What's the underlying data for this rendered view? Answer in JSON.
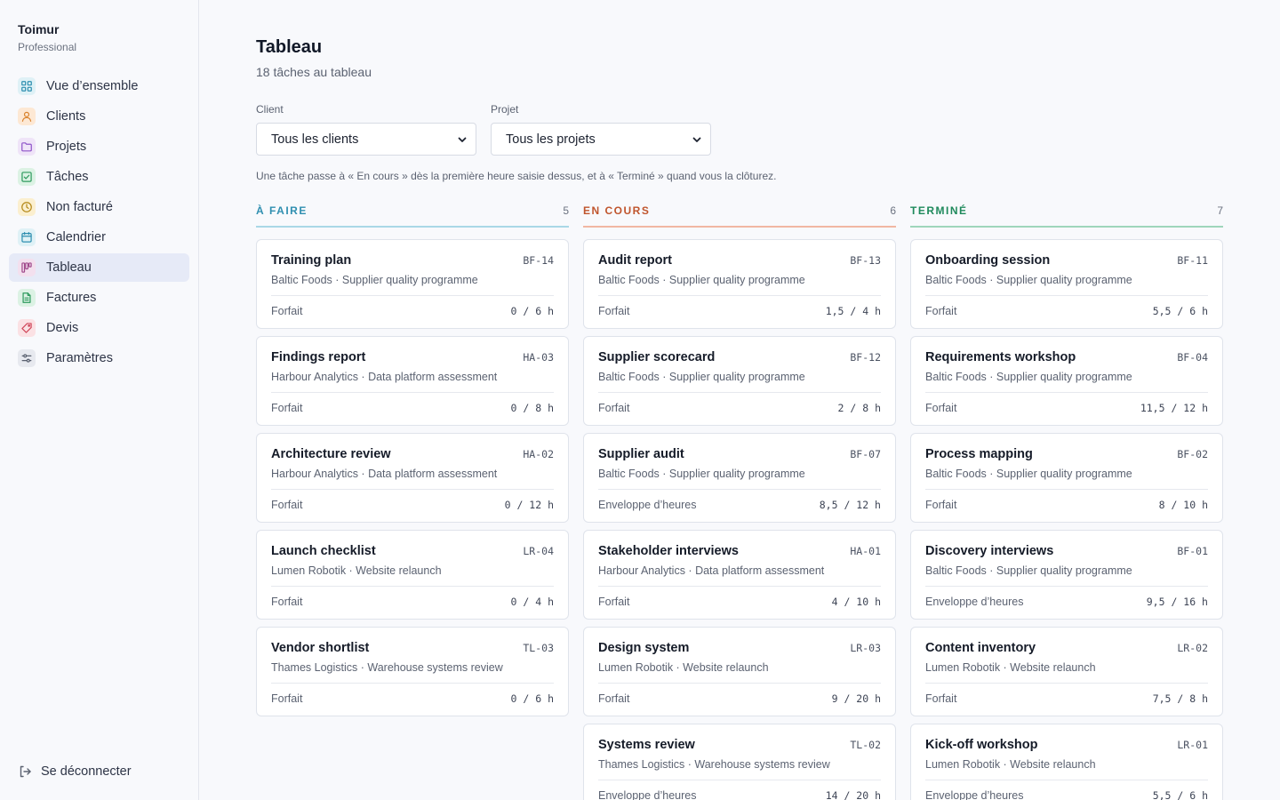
{
  "sidebar": {
    "brand": "Toimur",
    "plan": "Professional",
    "items": [
      {
        "label": "Vue d’ensemble",
        "icon": "grid-icon",
        "color": "#2f8fb0",
        "bg": "#dff1f6"
      },
      {
        "label": "Clients",
        "icon": "user-icon",
        "color": "#d9812b",
        "bg": "#fde8d4"
      },
      {
        "label": "Projets",
        "icon": "folder-icon",
        "color": "#8f55c9",
        "bg": "#efe4f8"
      },
      {
        "label": "Tâches",
        "icon": "checkbox-icon",
        "color": "#2e9a5e",
        "bg": "#dcf2e4"
      },
      {
        "label": "Non facturé",
        "icon": "clock-icon",
        "color": "#b58a1b",
        "bg": "#fbefcf"
      },
      {
        "label": "Calendrier",
        "icon": "calendar-icon",
        "color": "#2f8fb0",
        "bg": "#dff1f6"
      },
      {
        "label": "Tableau",
        "icon": "kanban-icon",
        "color": "#a04a8c",
        "bg": "#f3e0ee"
      },
      {
        "label": "Factures",
        "icon": "invoice-icon",
        "color": "#2e9a5e",
        "bg": "#dcf2e4"
      },
      {
        "label": "Devis",
        "icon": "tag-icon",
        "color": "#d0485b",
        "bg": "#fbe1e4"
      },
      {
        "label": "Paramètres",
        "icon": "sliders-icon",
        "color": "#5b6271",
        "bg": "#e7e9ef"
      }
    ],
    "active": "Tableau",
    "logout": "Se déconnecter"
  },
  "header": {
    "title": "Tableau",
    "subtitle": "18 tâches au tableau"
  },
  "filters": {
    "client_label": "Client",
    "client_value": "Tous les clients",
    "project_label": "Projet",
    "project_value": "Tous les projets"
  },
  "hint": "Une tâche passe à « En cours » dès la première heure saisie dessus, et à « Terminé » quand vous la clôturez.",
  "columns": [
    {
      "title": "À FAIRE",
      "count": "5",
      "color": "#2f8fb0",
      "line": "#a9d8e6",
      "cards": [
        {
          "title": "Training plan",
          "code": "BF-14",
          "meta": "Baltic Foods · Supplier quality programme",
          "type": "Forfait",
          "hours": "0 / 6 h"
        },
        {
          "title": "Findings report",
          "code": "HA-03",
          "meta": "Harbour Analytics · Data platform assessment",
          "type": "Forfait",
          "hours": "0 / 8 h"
        },
        {
          "title": "Architecture review",
          "code": "HA-02",
          "meta": "Harbour Analytics · Data platform assessment",
          "type": "Forfait",
          "hours": "0 / 12 h"
        },
        {
          "title": "Launch checklist",
          "code": "LR-04",
          "meta": "Lumen Robotik · Website relaunch",
          "type": "Forfait",
          "hours": "0 / 4 h"
        },
        {
          "title": "Vendor shortlist",
          "code": "TL-03",
          "meta": "Thames Logistics · Warehouse systems review",
          "type": "Forfait",
          "hours": "0 / 6 h"
        }
      ]
    },
    {
      "title": "EN COURS",
      "count": "6",
      "color": "#c0552d",
      "line": "#f1b7a3",
      "cards": [
        {
          "title": "Audit report",
          "code": "BF-13",
          "meta": "Baltic Foods · Supplier quality programme",
          "type": "Forfait",
          "hours": "1,5 / 4 h"
        },
        {
          "title": "Supplier scorecard",
          "code": "BF-12",
          "meta": "Baltic Foods · Supplier quality programme",
          "type": "Forfait",
          "hours": "2 / 8 h"
        },
        {
          "title": "Supplier audit",
          "code": "BF-07",
          "meta": "Baltic Foods · Supplier quality programme",
          "type": "Enveloppe d’heures",
          "hours": "8,5 / 12 h"
        },
        {
          "title": "Stakeholder interviews",
          "code": "HA-01",
          "meta": "Harbour Analytics · Data platform assessment",
          "type": "Forfait",
          "hours": "4 / 10 h"
        },
        {
          "title": "Design system",
          "code": "LR-03",
          "meta": "Lumen Robotik · Website relaunch",
          "type": "Forfait",
          "hours": "9 / 20 h"
        },
        {
          "title": "Systems review",
          "code": "TL-02",
          "meta": "Thames Logistics · Warehouse systems review",
          "type": "Enveloppe d’heures",
          "hours": "14 / 20 h"
        }
      ]
    },
    {
      "title": "TERMINÉ",
      "count": "7",
      "color": "#1f8a5c",
      "line": "#9fd6bb",
      "cards": [
        {
          "title": "Onboarding session",
          "code": "BF-11",
          "meta": "Baltic Foods · Supplier quality programme",
          "type": "Forfait",
          "hours": "5,5 / 6 h"
        },
        {
          "title": "Requirements workshop",
          "code": "BF-04",
          "meta": "Baltic Foods · Supplier quality programme",
          "type": "Forfait",
          "hours": "11,5 / 12 h"
        },
        {
          "title": "Process mapping",
          "code": "BF-02",
          "meta": "Baltic Foods · Supplier quality programme",
          "type": "Forfait",
          "hours": "8 / 10 h"
        },
        {
          "title": "Discovery interviews",
          "code": "BF-01",
          "meta": "Baltic Foods · Supplier quality programme",
          "type": "Enveloppe d’heures",
          "hours": "9,5 / 16 h"
        },
        {
          "title": "Content inventory",
          "code": "LR-02",
          "meta": "Lumen Robotik · Website relaunch",
          "type": "Forfait",
          "hours": "7,5 / 8 h"
        },
        {
          "title": "Kick-off workshop",
          "code": "LR-01",
          "meta": "Lumen Robotik · Website relaunch",
          "type": "Enveloppe d’heures",
          "hours": "5,5 / 6 h"
        }
      ]
    }
  ]
}
